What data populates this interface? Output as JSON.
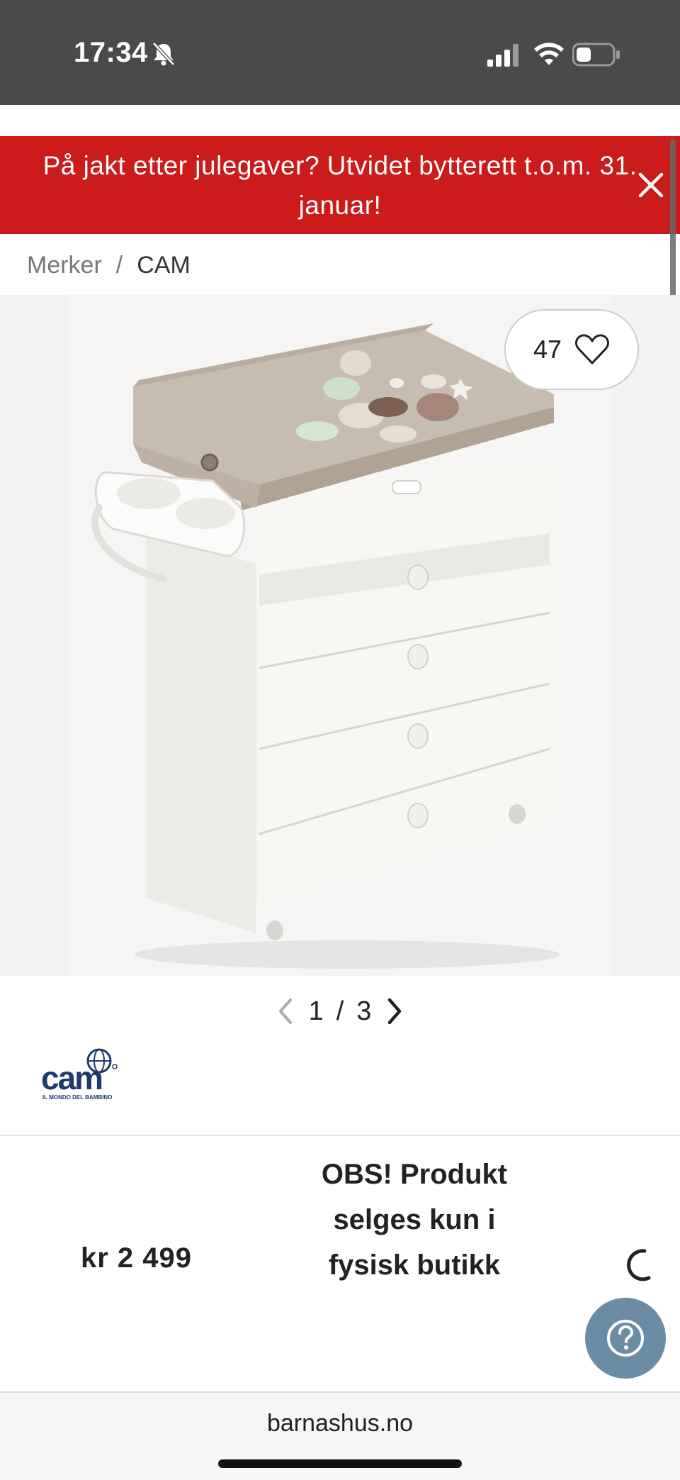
{
  "status_bar": {
    "time": "17:34",
    "icons": [
      "bell-off-icon",
      "cellular-signal-icon",
      "wifi-icon",
      "battery-icon"
    ]
  },
  "promo_banner": {
    "text": "På jakt etter julegaver? Utvidet bytterett t.o.m. 31. januar!",
    "background_color": "#cc1b1b"
  },
  "breadcrumb": {
    "items": [
      "Merker",
      "CAM"
    ],
    "separator": "/"
  },
  "product": {
    "image_alt": "changing-table-dresser",
    "likes": "47",
    "gallery": {
      "current": "1",
      "separator": "/",
      "total": "3"
    },
    "brand_logo_text": "cam",
    "brand_logo_tagline": "IL MONDO DEL BAMBINO",
    "price": "kr 2 499",
    "notice": "OBS! Produkt selges kun i fysisk butikk"
  },
  "browser": {
    "url": "barnashus.no"
  },
  "colors": {
    "accent_red": "#cc1b1b",
    "help_button": "#6a8ca4",
    "brand_blue": "#1f3a6e"
  }
}
